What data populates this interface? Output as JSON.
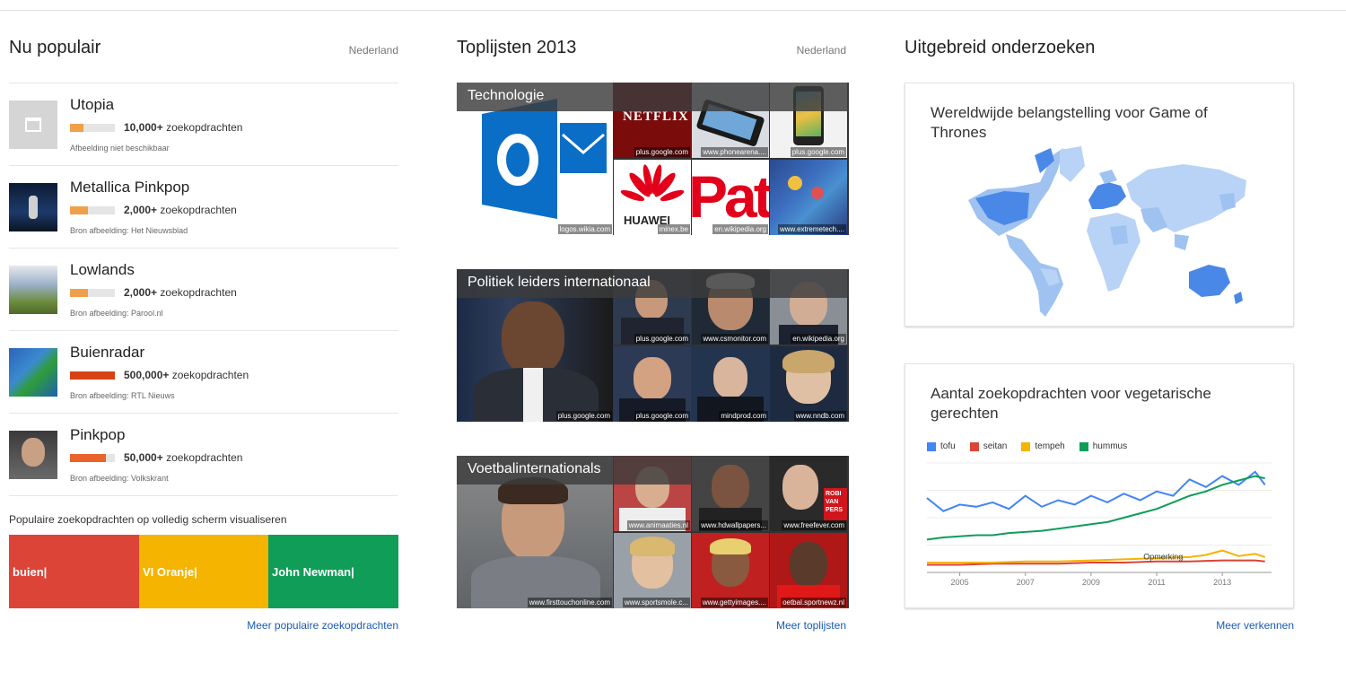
{
  "popular": {
    "title": "Nu populair",
    "region": "Nederland",
    "items": [
      {
        "title": "Utopia",
        "count": "10,000+",
        "unit": "zoekopdrachten",
        "source": "Afbeelding niet beschikbaar",
        "level": 0.3,
        "color": "#f0a04b"
      },
      {
        "title": "Metallica Pinkpop",
        "count": "2,000+",
        "unit": "zoekopdrachten",
        "source": "Bron afbeelding: Het Nieuwsblad",
        "level": 0.4,
        "color": "#f0a04b"
      },
      {
        "title": "Lowlands",
        "count": "2,000+",
        "unit": "zoekopdrachten",
        "source": "Bron afbeelding: Parool.nl",
        "level": 0.4,
        "color": "#f0a04b"
      },
      {
        "title": "Buienradar",
        "count": "500,000+",
        "unit": "zoekopdrachten",
        "source": "Bron afbeelding: RTL Nieuws",
        "level": 1.0,
        "color": "#d84315"
      },
      {
        "title": "Pinkpop",
        "count": "50,000+",
        "unit": "zoekopdrachten",
        "source": "Bron afbeelding: Volkskrant",
        "level": 0.8,
        "color": "#e8642c"
      }
    ],
    "viz_label": "Populaire zoekopdrachten op volledig scherm visualiseren",
    "viz_tiles": [
      {
        "text": "buien|",
        "color": "#dc4437"
      },
      {
        "text": "VI Oranje|",
        "color": "#f4b400"
      },
      {
        "text": "John Newman|",
        "color": "#109d58"
      }
    ],
    "more_link": "Meer populaire zoekopdrachten"
  },
  "toplists": {
    "title": "Toplijsten 2013",
    "region": "Nederland",
    "lists": [
      {
        "title": "Technologie",
        "big_source": "logos.wikia.com",
        "small_sources": [
          "plus.google.com",
          "www.phonearena....",
          "plus.google.com",
          "minex.be",
          "en.wikipedia.org",
          "www.extremetech...."
        ]
      },
      {
        "title": "Politiek leiders internationaal",
        "big_source": "plus.google.com",
        "small_sources": [
          "plus.google.com",
          "www.csmonitor.com",
          "en.wikipedia.org",
          "plus.google.com",
          "mindprod.com",
          "www.nndb.com"
        ]
      },
      {
        "title": "Voetbalinternationals",
        "big_source": "www.firsttouchonline.com",
        "small_sources": [
          "www.animaaties.nl",
          "www.hdwallpapers...",
          "www.freefever.com",
          "www.sportsmole.c...",
          "www.gettyimages....",
          "oetbal.sportnewz.nl"
        ]
      }
    ],
    "logo_texts": {
      "netflix": "NETFLIX",
      "huawei": "HUAWEI",
      "outlook": "O",
      "robin": "ROBI VAN PERS"
    },
    "more_link": "Meer toplijsten"
  },
  "explore": {
    "title": "Uitgebreid onderzoeken",
    "map_card": {
      "title": "Wereldwijde belangstelling voor Game of Thrones"
    },
    "chart_card": {
      "title": "Aantal zoekopdrachten voor vegetarische gerechten"
    },
    "more_link": "Meer verkennen"
  },
  "chart_data": {
    "type": "line",
    "title": "Aantal zoekopdrachten voor vegetarische gerechten",
    "x_ticks": [
      "2005",
      "2007",
      "2009",
      "2011",
      "2013"
    ],
    "xlim": [
      2004,
      2014.5
    ],
    "ylim": [
      0,
      100
    ],
    "grid": true,
    "legend_position": "top-left",
    "annotation": "Opmerking",
    "series": [
      {
        "name": "tofu",
        "color": "#4285f4",
        "x": [
          2004,
          2004.5,
          2005,
          2005.5,
          2006,
          2006.5,
          2007,
          2007.5,
          2008,
          2008.5,
          2009,
          2009.5,
          2010,
          2010.5,
          2011,
          2011.5,
          2012,
          2012.5,
          2013,
          2013.5,
          2014,
          2014.3
        ],
        "values": [
          68,
          56,
          62,
          60,
          64,
          58,
          70,
          60,
          66,
          62,
          70,
          64,
          72,
          66,
          74,
          70,
          85,
          78,
          88,
          80,
          92,
          80
        ]
      },
      {
        "name": "seitan",
        "color": "#db4437",
        "x": [
          2004,
          2005,
          2006,
          2007,
          2008,
          2009,
          2010,
          2011,
          2012,
          2013,
          2014,
          2014.3
        ],
        "values": [
          7,
          7,
          8,
          8,
          8,
          9,
          9,
          10,
          10,
          11,
          11,
          10
        ]
      },
      {
        "name": "tempeh",
        "color": "#f4b400",
        "x": [
          2004,
          2005,
          2006,
          2007,
          2008,
          2009,
          2010,
          2011,
          2012,
          2012.5,
          2013,
          2013.5,
          2014,
          2014.3
        ],
        "values": [
          9,
          9,
          9,
          10,
          10,
          11,
          12,
          13,
          14,
          16,
          20,
          15,
          17,
          14
        ]
      },
      {
        "name": "hummus",
        "color": "#0f9d58",
        "x": [
          2004,
          2004.5,
          2005,
          2005.5,
          2006,
          2006.5,
          2007,
          2007.5,
          2008,
          2008.5,
          2009,
          2009.5,
          2010,
          2010.5,
          2011,
          2011.5,
          2012,
          2012.5,
          2013,
          2013.5,
          2014,
          2014.3
        ],
        "values": [
          30,
          32,
          33,
          34,
          34,
          36,
          37,
          38,
          40,
          42,
          44,
          46,
          50,
          54,
          58,
          64,
          70,
          74,
          80,
          84,
          88,
          86
        ]
      }
    ]
  }
}
